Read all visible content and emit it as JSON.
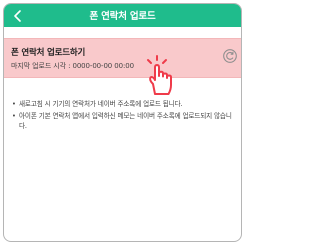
{
  "header": {
    "title": "폰 연락처 업로드",
    "back_icon": "chevron-left-icon"
  },
  "upload_row": {
    "title": "폰 연락처 업로드하기",
    "last_upload_label": "마지막 업로드 시각 : 0000-00-00 00:00",
    "sync_icon": "sync-icon",
    "background_color": "#f9c9cb"
  },
  "notes": [
    "새로고침 시 기기의 연락처가 네이버 주소록에 업로드 됩니다.",
    "아이폰 기본 연락처 앱에서 입력하신 메모는 네이버 주소록에 업로드되지 않습니다."
  ],
  "colors": {
    "accent": "#1fbc8c",
    "highlight": "#f9c9cb",
    "hand": "#ef3b4a"
  }
}
